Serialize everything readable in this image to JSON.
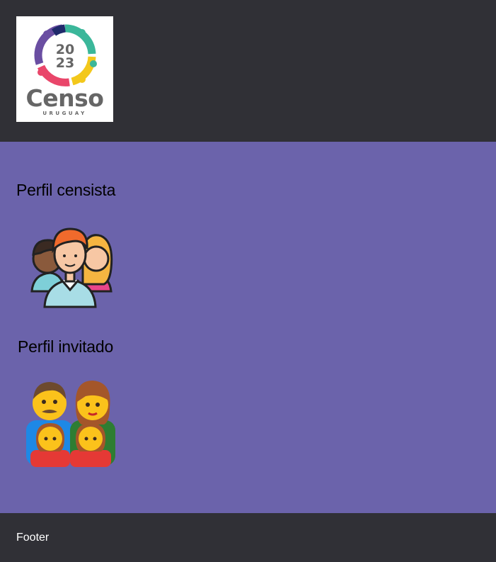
{
  "header": {
    "logo": {
      "year_top": "20",
      "year_bottom": "23",
      "word": "Censo",
      "country": "URUGUAY"
    }
  },
  "profiles": [
    {
      "title": "Perfil censista",
      "icon": "people-group-icon"
    },
    {
      "title": "Perfil invitado",
      "icon": "family-icon"
    }
  ],
  "footer": {
    "text": "Footer"
  },
  "colors": {
    "header_bg": "#303036",
    "content_bg": "#6b63ab",
    "footer_bg": "#303036"
  }
}
